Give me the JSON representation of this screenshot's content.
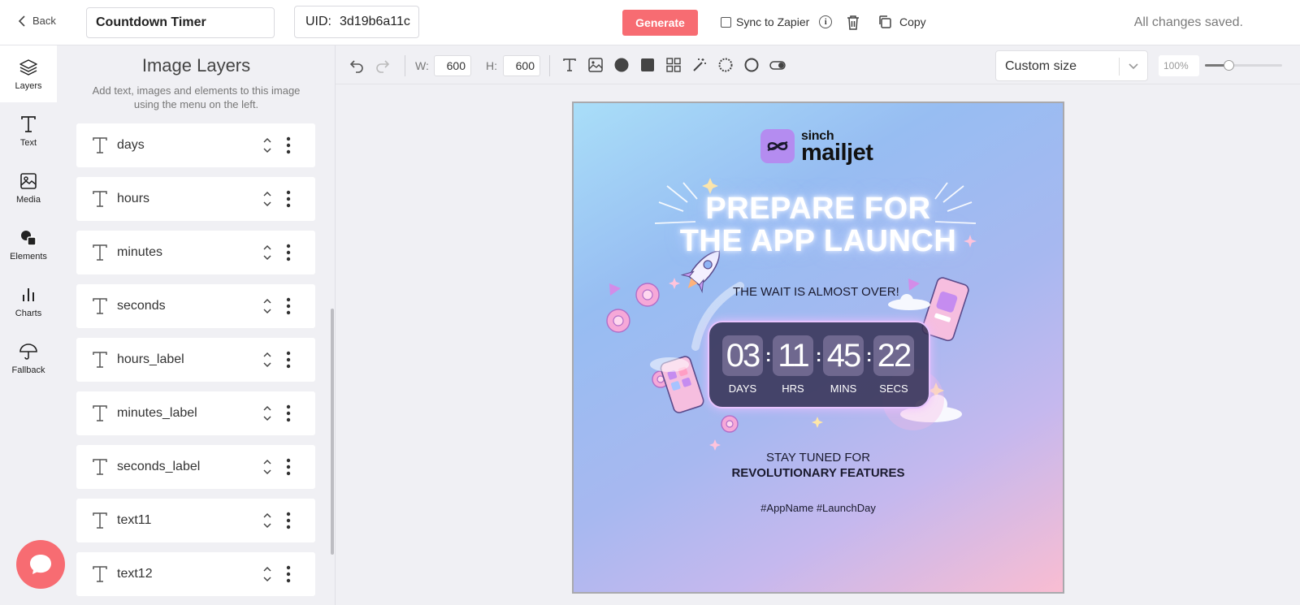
{
  "header": {
    "back_label": "Back",
    "project_name": "Countdown Timer",
    "uid_label": "UID:",
    "uid_value": "3d19b6a11c",
    "generate_label": "Generate",
    "sync_label": "Sync to Zapier",
    "copy_label": "Copy",
    "status": "All changes saved."
  },
  "rail": {
    "items": [
      {
        "label": "Layers",
        "icon": "layers-icon"
      },
      {
        "label": "Text",
        "icon": "text-icon"
      },
      {
        "label": "Media",
        "icon": "image-icon"
      },
      {
        "label": "Elements",
        "icon": "elements-icon"
      },
      {
        "label": "Charts",
        "icon": "chart-icon"
      },
      {
        "label": "Fallback",
        "icon": "umbrella-icon"
      }
    ]
  },
  "panel": {
    "title": "Image Layers",
    "subtitle": "Add text, images and elements to this image using the menu on the left.",
    "layers": [
      "days",
      "hours",
      "minutes",
      "seconds",
      "hours_label",
      "minutes_label",
      "seconds_label",
      "text11",
      "text12"
    ]
  },
  "toolbar": {
    "w_label": "W:",
    "w_value": "600",
    "h_label": "H:",
    "h_value": "600",
    "size_preset": "Custom size",
    "zoom": "100%",
    "zoom_level": 0.3
  },
  "canvas": {
    "brand_small": "sinch",
    "brand_big": "mailjet",
    "headline_1": "PREPARE FOR",
    "headline_2": "THE APP LAUNCH",
    "tagline": "THE WAIT IS ALMOST OVER!",
    "countdown": [
      {
        "value": "03",
        "label": "DAYS"
      },
      {
        "value": "11",
        "label": "HRS"
      },
      {
        "value": "45",
        "label": "MINS"
      },
      {
        "value": "22",
        "label": "SECS"
      }
    ],
    "stay_tuned": "STAY TUNED FOR",
    "features": "REVOLUTIONARY FEATURES",
    "hashtags": "#AppName #LaunchDay"
  },
  "colors": {
    "accent": "#f76c72",
    "brand_purple": "#b48cf0"
  }
}
